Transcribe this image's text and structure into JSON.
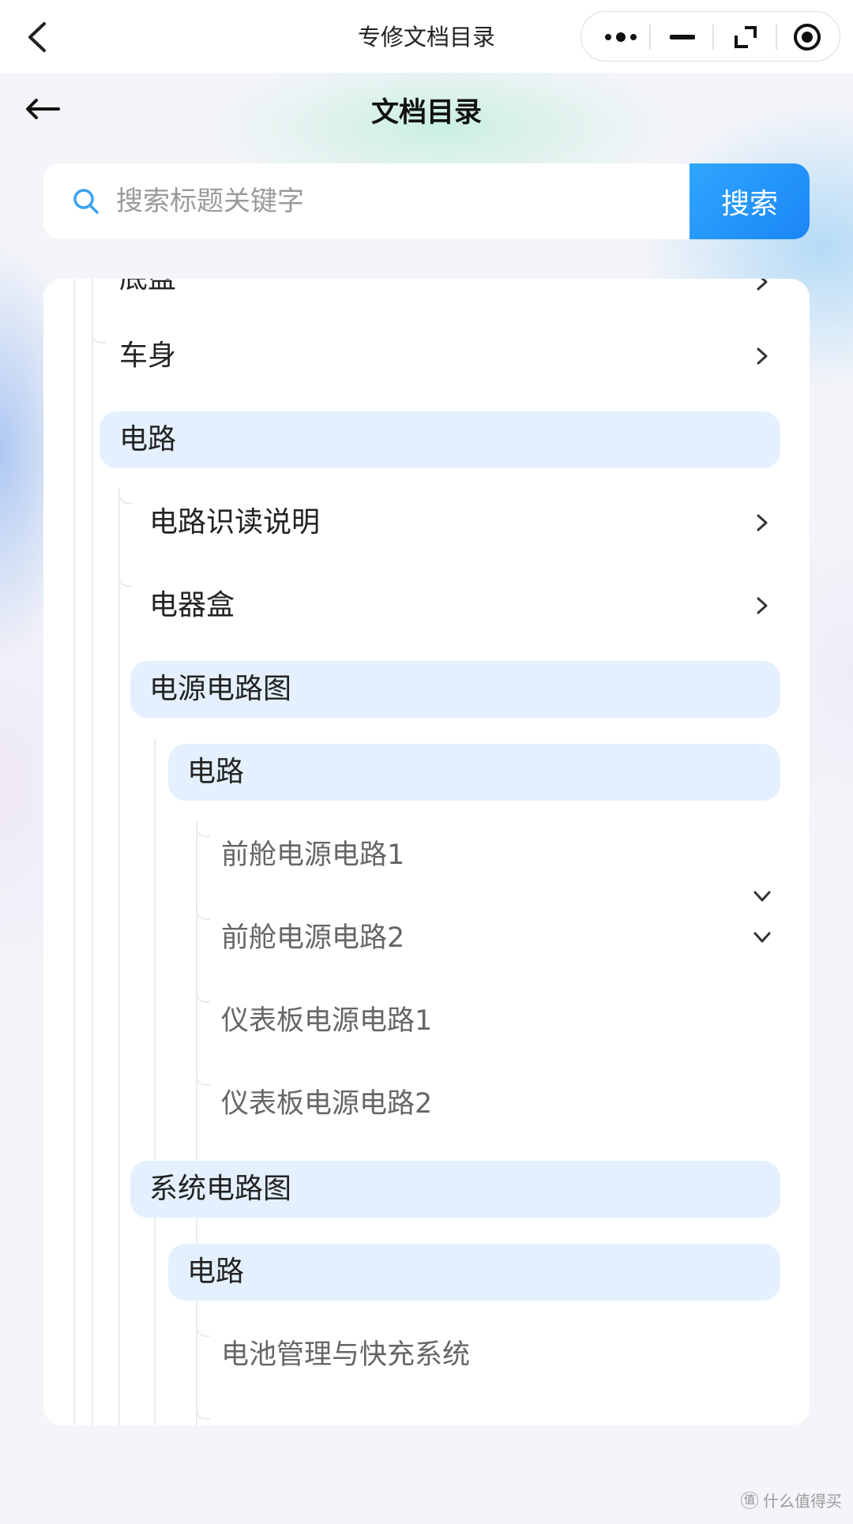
{
  "top_bar": {
    "title": "专修文档目录"
  },
  "header": {
    "title": "文档目录"
  },
  "search": {
    "placeholder": "搜索标题关键字",
    "button_label": "搜索"
  },
  "tree": {
    "partial_item": "底盘",
    "level1": [
      {
        "label": "车身"
      },
      {
        "label": "电路"
      }
    ],
    "circuit_children": [
      {
        "label": "电路识读说明"
      },
      {
        "label": "电器盒"
      },
      {
        "label": "电源电路图"
      }
    ],
    "power_group": {
      "label": "电路",
      "leaves": [
        {
          "label": "前舱电源电路1"
        },
        {
          "label": "前舱电源电路2"
        },
        {
          "label": "仪表板电源电路1"
        },
        {
          "label": "仪表板电源电路2"
        }
      ]
    },
    "system_diagram": {
      "label": "系统电路图"
    },
    "system_group": {
      "label": "电路",
      "leaves": [
        {
          "label": "电池管理与快充系统"
        }
      ]
    }
  },
  "watermark": {
    "text": "什么值得买",
    "logo_char": "值"
  },
  "colors": {
    "accent": "#1b86f5",
    "highlight": "#e4f0fd"
  }
}
